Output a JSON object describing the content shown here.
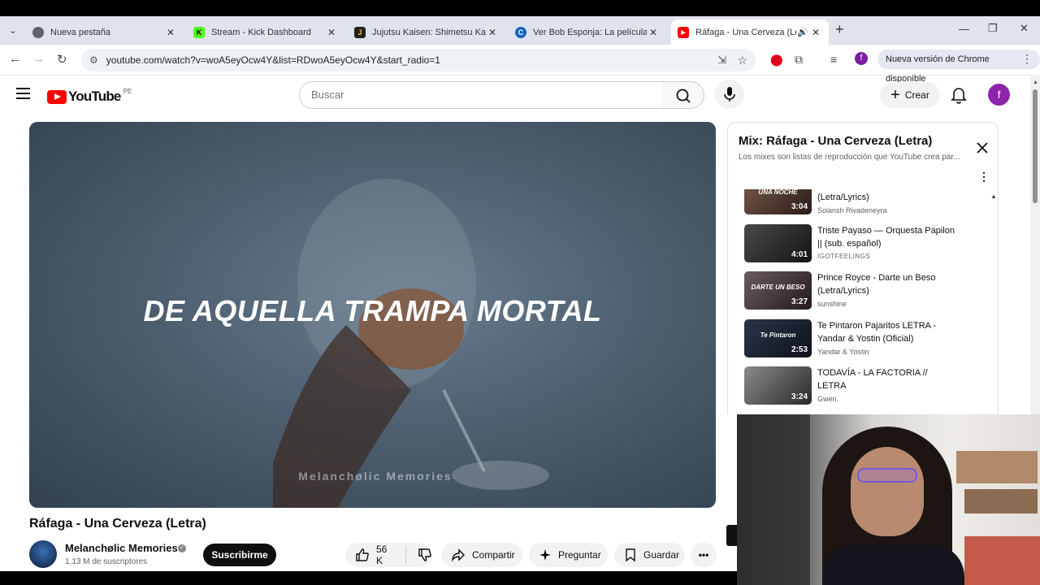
{
  "browser": {
    "tabs": [
      {
        "title": "Nueva pestaña",
        "favicon_color": "#5f6368",
        "favicon_glyph": ""
      },
      {
        "title": "Stream - Kick Dashboard",
        "favicon_color": "#53fc18",
        "favicon_glyph": "K"
      },
      {
        "title": "Jujutsu Kaisen: Shimetsu Kaiyuu",
        "favicon_color": "#222222",
        "favicon_glyph": "J"
      },
      {
        "title": "Ver Bob Esponja: La película Or",
        "favicon_color": "#1565c0",
        "favicon_glyph": "C"
      },
      {
        "title": "Ráfaga - Una Cerveza (Letra)",
        "favicon_color": "#ff0000",
        "favicon_glyph": "▶"
      }
    ],
    "url": "youtube.com/watch?v=woA5eyOcw4Y&list=RDwoA5eyOcw4Y&start_radio=1",
    "profile_initial": "f",
    "update_label": "Nueva versión de Chrome disponible"
  },
  "youtube": {
    "logo_text": "YouTube",
    "country_code": "PE",
    "search_placeholder": "Buscar",
    "create_label": "Crear",
    "avatar_initial": "f"
  },
  "video": {
    "caption": "DE AQUELLA TRAMPA MORTAL",
    "watermark": "Melanchølic Memories",
    "title": "Ráfaga - Una Cerveza (Letra)",
    "channel": "Melanchølic Memories",
    "subscribers": "1,13 M de suscriptores",
    "subscribe_label": "Suscribirme",
    "likes": "56 K",
    "share_label": "Compartir",
    "ask_label": "Preguntar",
    "save_label": "Guardar"
  },
  "playlist": {
    "title": "Mix: Ráfaga - Una Cerveza (Letra)",
    "subtitle": "Los mixes son listas de reproducción que YouTube crea par...",
    "items": [
      {
        "title": "(Letra/Lyrics)",
        "artist": "Solansh Rivadeneyra",
        "duration": "3:04",
        "thumb_text": "UNA NOCHE"
      },
      {
        "title": "Triste Payaso — Orquesta Papilon || (sub. español)",
        "artist": "IGOTFEELINGS",
        "duration": "4:01",
        "thumb_text": ""
      },
      {
        "title": "Prince Royce - Darte un Beso (Letra/Lyrics)",
        "artist": "sunshine",
        "duration": "3:27",
        "thumb_text": "DARTE UN BESO"
      },
      {
        "title": "Te Pintaron Pajaritos LETRA - Yandar & Yostin (Oficial)",
        "artist": "Yandar & Yostin",
        "duration": "2:53",
        "thumb_text": "Te Pintaron"
      },
      {
        "title": "TODAVÍA - LA FACTORIA // LETRA",
        "artist": "Gwen.",
        "duration": "3:24",
        "thumb_text": ""
      }
    ]
  }
}
